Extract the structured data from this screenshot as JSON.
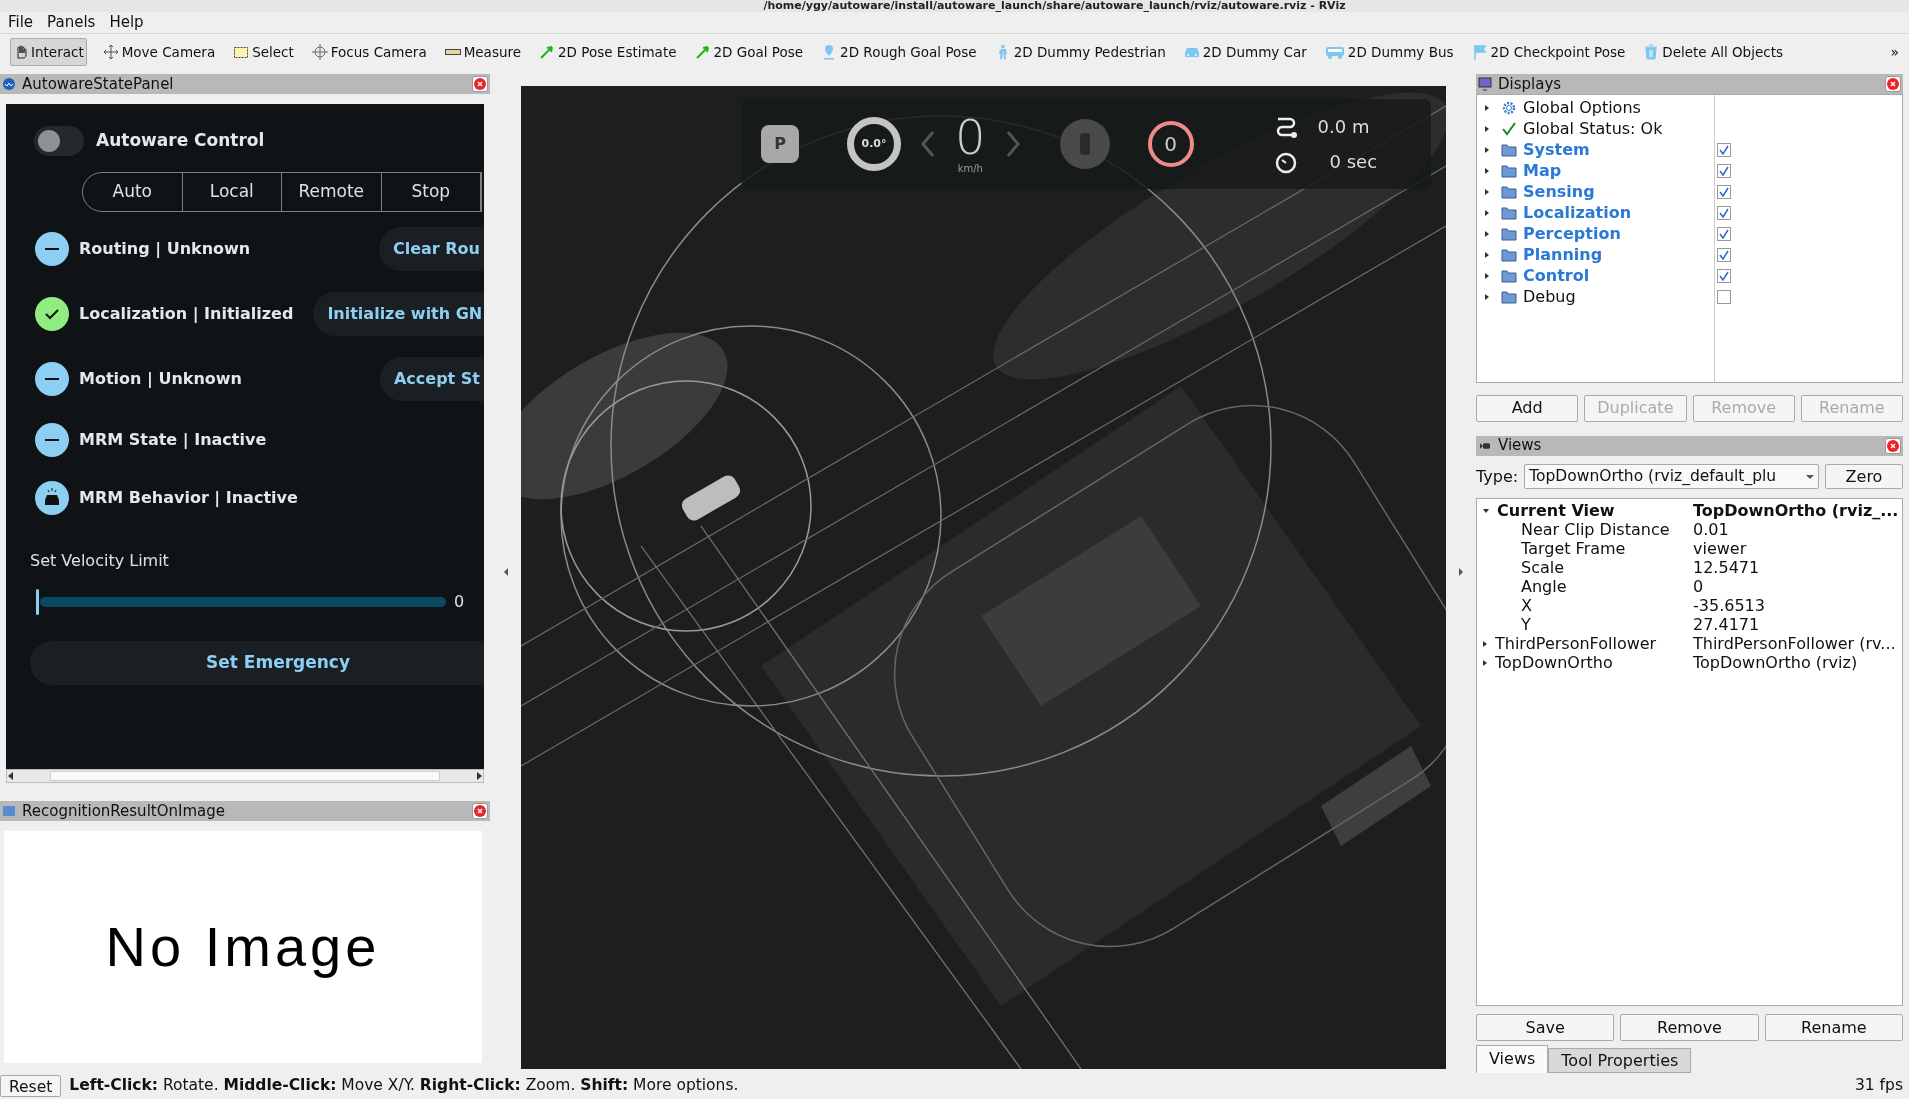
{
  "window": {
    "title": "/home/ygy/autoware/install/autoware_launch/share/autoware_launch/rviz/autoware.rviz - RViz"
  },
  "menu": [
    "File",
    "Panels",
    "Help"
  ],
  "toolbar": [
    {
      "label": "Interact",
      "selected": true
    },
    {
      "label": "Move Camera",
      "selected": false
    },
    {
      "label": "Select",
      "selected": false
    },
    {
      "label": "Focus Camera",
      "selected": false
    },
    {
      "label": "Measure",
      "selected": false
    },
    {
      "label": "2D Pose Estimate",
      "selected": false
    },
    {
      "label": "2D Goal Pose",
      "selected": false
    },
    {
      "label": "2D Rough Goal Pose",
      "selected": false
    },
    {
      "label": "2D Dummy Pedestrian",
      "selected": false
    },
    {
      "label": "2D Dummy Car",
      "selected": false
    },
    {
      "label": "2D Dummy Bus",
      "selected": false
    },
    {
      "label": "2D Checkpoint Pose",
      "selected": false
    },
    {
      "label": "Delete All Objects",
      "selected": false
    }
  ],
  "toolbar_more": "»",
  "state_panel": {
    "title": "AutowareStatePanel",
    "control": {
      "label": "Autoware Control",
      "on": false
    },
    "modes": [
      {
        "label": "Auto",
        "selected": false
      },
      {
        "label": "Local",
        "selected": false
      },
      {
        "label": "Remote",
        "selected": false
      },
      {
        "label": "Stop",
        "selected": false
      }
    ],
    "states": [
      {
        "label": "Routing | Unknown",
        "kind": "minus",
        "color": "#8dcff3",
        "button": "Clear Rou"
      },
      {
        "label": "Localization | Initialized",
        "kind": "check",
        "color": "#90ee80",
        "button": "Initialize with GN"
      },
      {
        "label": "Motion | Unknown",
        "kind": "minus",
        "color": "#8dcff3",
        "button": "Accept St"
      },
      {
        "label": "MRM State | Inactive",
        "kind": "minus",
        "color": "#8dcff3"
      },
      {
        "label": "MRM Behavior | Inactive",
        "kind": "car",
        "color": "#8dcff3"
      }
    ],
    "velocity": {
      "label": "Set Velocity Limit",
      "level": 0,
      "reading": "0"
    },
    "emergency_button": "Set Emergency"
  },
  "image_panel": {
    "title": "RecognitionResultOnImage",
    "message": "No Image"
  },
  "hud": {
    "gear": "P",
    "steering": "0.0°",
    "speed": "0",
    "speed_unit": "km/h",
    "limit": "0",
    "distance": "0.0 m",
    "time": "0 sec"
  },
  "displays": {
    "title": "Displays",
    "items": [
      {
        "label": "Global Options",
        "kind": "options"
      },
      {
        "label": "Global Status: Ok",
        "kind": "status"
      },
      {
        "label": "System",
        "kind": "group",
        "checked": true
      },
      {
        "label": "Map",
        "kind": "group",
        "checked": true
      },
      {
        "label": "Sensing",
        "kind": "group",
        "checked": true
      },
      {
        "label": "Localization",
        "kind": "group",
        "checked": true
      },
      {
        "label": "Perception",
        "kind": "group",
        "checked": true
      },
      {
        "label": "Planning",
        "kind": "group",
        "checked": true
      },
      {
        "label": "Control",
        "kind": "group",
        "checked": true
      },
      {
        "label": "Debug",
        "kind": "group",
        "checked": false
      }
    ],
    "buttons": [
      {
        "label": "Add",
        "disabled": false
      },
      {
        "label": "Duplicate",
        "disabled": true
      },
      {
        "label": "Remove",
        "disabled": true
      },
      {
        "label": "Rename",
        "disabled": true
      }
    ]
  },
  "views": {
    "title": "Views",
    "type_label": "Type:",
    "type_value": "TopDownOrtho (rviz_default_plu",
    "zero_button": "Zero",
    "tree": [
      {
        "name": "Current View",
        "value": "TopDownOrtho (rviz_...",
        "expanded": true,
        "children": [
          {
            "name": "Near Clip Distance",
            "value": "0.01"
          },
          {
            "name": "Target Frame",
            "value": "viewer"
          },
          {
            "name": "Scale",
            "value": "12.5471"
          },
          {
            "name": "Angle",
            "value": "0"
          },
          {
            "name": "X",
            "value": "-35.6513"
          },
          {
            "name": "Y",
            "value": "27.4171"
          }
        ]
      },
      {
        "name": "ThirdPersonFollower",
        "value": "ThirdPersonFollower (rv...",
        "expanded": false
      },
      {
        "name": "TopDownOrtho",
        "value": "TopDownOrtho (rviz)",
        "expanded": false
      }
    ],
    "buttons": [
      "Save",
      "Remove",
      "Rename"
    ]
  },
  "tabs": [
    {
      "label": "Views",
      "selected": true
    },
    {
      "label": "Tool Properties",
      "selected": false
    }
  ],
  "status_bar": {
    "reset_button": "Reset",
    "help": "**Left-Click:** Rotate. **Middle-Click:** Move X/Y. **Right-Click:** Zoom. **Shift:** More options.",
    "fps": "31 fps"
  }
}
